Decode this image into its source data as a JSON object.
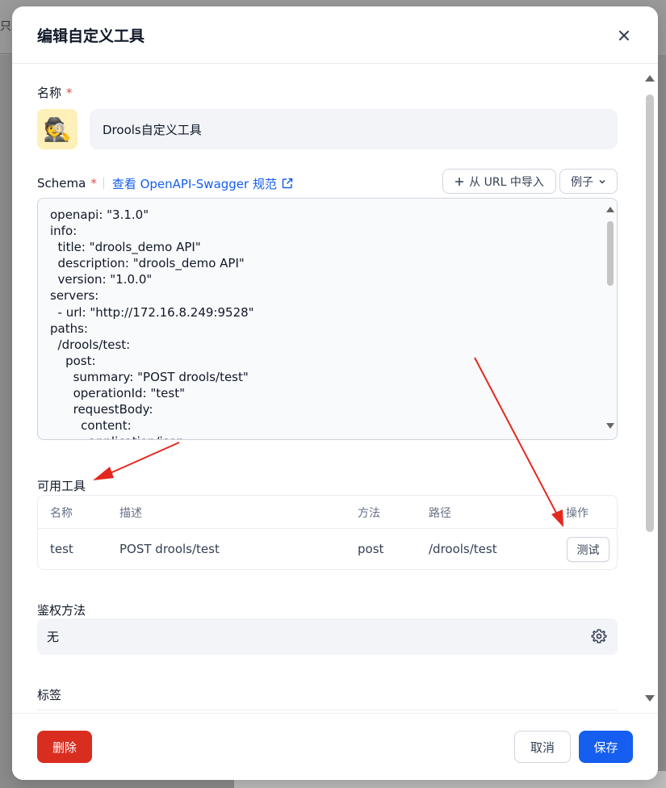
{
  "backdrop": {
    "partial_text": "只耳"
  },
  "dialog": {
    "title": "编辑自定义工具",
    "close_label": "×"
  },
  "name_field": {
    "label": "名称",
    "required_mark": "*",
    "avatar_emoji": "🕵️",
    "value": "Drools自定义工具"
  },
  "schema": {
    "label": "Schema",
    "required_mark": "*",
    "view_link": "查看 OpenAPI-Swagger 规范",
    "import_button": "从 URL 中导入",
    "example_button": "例子",
    "code": "openapi: \"3.1.0\"\ninfo:\n  title: \"drools_demo API\"\n  description: \"drools_demo API\"\n  version: \"1.0.0\"\nservers:\n  - url: \"http://172.16.8.249:9528\"\npaths:\n  /drools/test:\n    post:\n      summary: \"POST drools/test\"\n      operationId: \"test\"\n      requestBody:\n        content:\n          application/json:"
  },
  "tools": {
    "label": "可用工具",
    "columns": {
      "name": "名称",
      "desc": "描述",
      "method": "方法",
      "path": "路径",
      "action": "操作"
    },
    "rows": [
      {
        "name": "test",
        "desc": "POST drools/test",
        "method": "post",
        "path": "/drools/test",
        "action": "测试"
      }
    ]
  },
  "auth": {
    "label": "鉴权方法",
    "value": "无"
  },
  "tags": {
    "label": "标签"
  },
  "footer": {
    "delete": "删除",
    "cancel": "取消",
    "save": "保存"
  },
  "colors": {
    "primary": "#155eef",
    "danger": "#d92d20",
    "annotation": "#e5281e"
  }
}
